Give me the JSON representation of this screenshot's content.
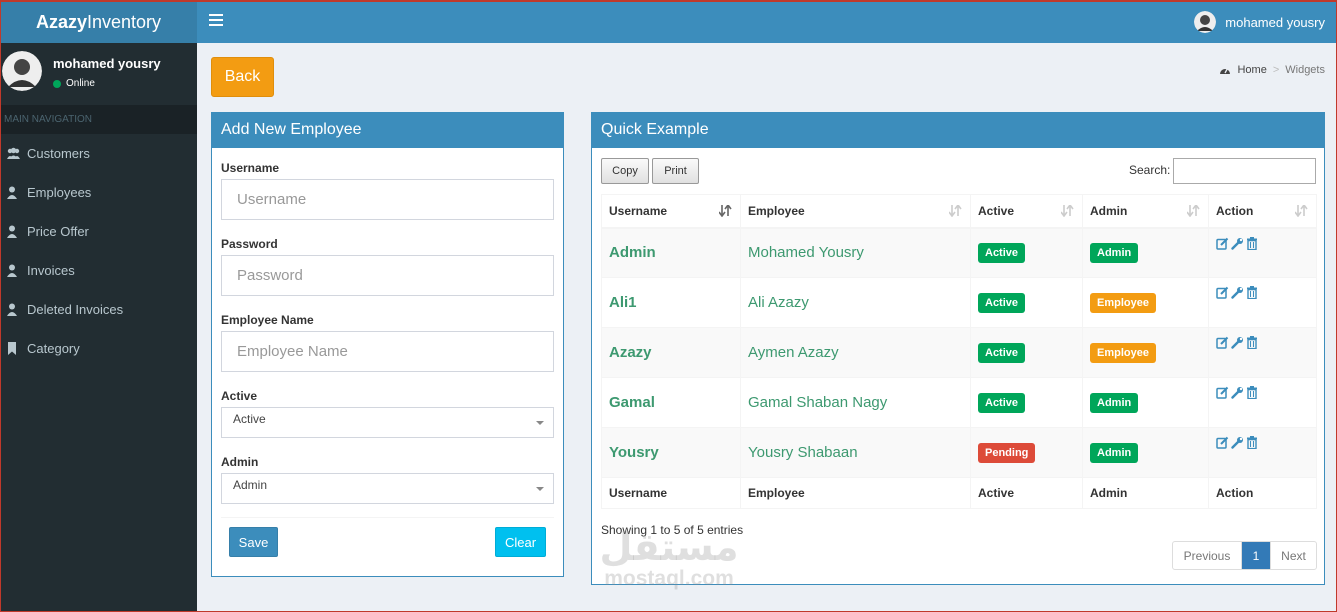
{
  "app": {
    "logo_bold": "Azazy",
    "logo_rest": "Inventory"
  },
  "topbar": {
    "user_name": "mohamed yousry"
  },
  "sidebar": {
    "user_name": "mohamed yousry",
    "status": "Online",
    "nav_header": "MAIN NAVIGATION",
    "items": [
      {
        "label": "Customers",
        "icon": "users-icon"
      },
      {
        "label": "Employees",
        "icon": "user-icon"
      },
      {
        "label": "Price Offer",
        "icon": "user-icon"
      },
      {
        "label": "Invoices",
        "icon": "user-icon"
      },
      {
        "label": "Deleted Invoices",
        "icon": "user-icon"
      },
      {
        "label": "Category",
        "icon": "bookmark-icon"
      }
    ]
  },
  "content": {
    "back_label": "Back"
  },
  "breadcrumb": {
    "home": "Home",
    "current": "Widgets"
  },
  "form": {
    "title": "Add New Employee",
    "username_label": "Username",
    "username_placeholder": "Username",
    "password_label": "Password",
    "password_placeholder": "Password",
    "employee_name_label": "Employee Name",
    "employee_name_placeholder": "Employee Name",
    "active_label": "Active",
    "active_value": "Active",
    "admin_label": "Admin",
    "admin_value": "Admin",
    "save_label": "Save",
    "clear_label": "Clear"
  },
  "table": {
    "title": "Quick Example",
    "copy_label": "Copy",
    "print_label": "Print",
    "search_label": "Search:",
    "columns": [
      "Username",
      "Employee",
      "Active",
      "Admin",
      "Action"
    ],
    "rows": [
      {
        "username": "Admin",
        "employee": "Mohamed Yousry",
        "active": "Active",
        "admin": "Admin"
      },
      {
        "username": "Ali1",
        "employee": "Ali Azazy",
        "active": "Active",
        "admin": "Employee"
      },
      {
        "username": "Azazy",
        "employee": "Aymen Azazy",
        "active": "Active",
        "admin": "Employee"
      },
      {
        "username": "Gamal",
        "employee": "Gamal Shaban Nagy",
        "active": "Active",
        "admin": "Admin"
      },
      {
        "username": "Yousry",
        "employee": "Yousry Shabaan",
        "active": "Pending",
        "admin": "Admin"
      }
    ],
    "info": "Showing 1 to 5 of 5 entries",
    "pagination": {
      "previous": "Previous",
      "page": "1",
      "next": "Next"
    }
  },
  "watermark": {
    "arabic": "مستقل",
    "latin": "mostaql.com"
  },
  "colors": {
    "primary": "#3c8dbc",
    "success": "#00a65a",
    "warning": "#f39c12",
    "danger": "#dd4b39",
    "info": "#00c0ef",
    "sidebar": "#222d32"
  }
}
